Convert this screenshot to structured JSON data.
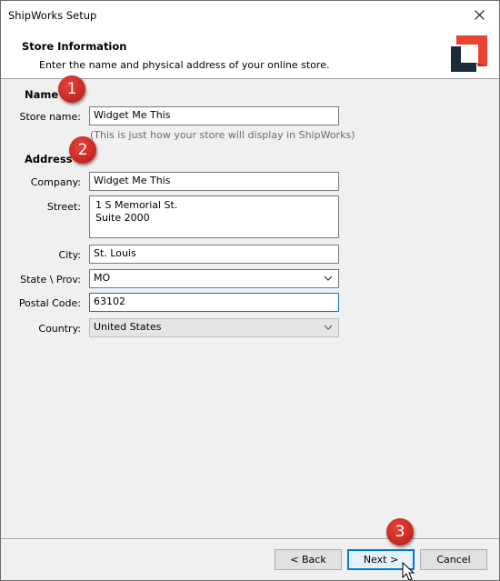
{
  "window": {
    "title": "ShipWorks Setup"
  },
  "header": {
    "title": "Store Information",
    "subtitle": "Enter the name and physical address of your online store."
  },
  "name_section": {
    "heading": "Name",
    "store_name_label": "Store name:",
    "store_name_value": "Widget Me This",
    "hint": "(This is just how your store will display in ShipWorks)"
  },
  "address_section": {
    "heading": "Address",
    "company_label": "Company:",
    "company_value": "Widget Me This",
    "street_label": "Street:",
    "street_value": "1 S Memorial St.\nSuite 2000",
    "city_label": "City:",
    "city_value": "St. Louis",
    "state_label": "State \\ Prov:",
    "state_value": "MO",
    "postal_label": "Postal Code:",
    "postal_value": "63102",
    "country_label": "Country:",
    "country_value": "United States"
  },
  "badges": [
    "1",
    "2",
    "3"
  ],
  "buttons": {
    "back": "< Back",
    "next": "Next >",
    "cancel": "Cancel"
  },
  "colors": {
    "logo_dark": "#1c2b3a",
    "logo_accent": "#e8442f",
    "badge": "#c8231d",
    "focus": "#0078d7"
  },
  "icons": {
    "close": "close-icon",
    "dropdown": "chevron-down-icon",
    "cursor": "mouse-pointer-icon"
  }
}
